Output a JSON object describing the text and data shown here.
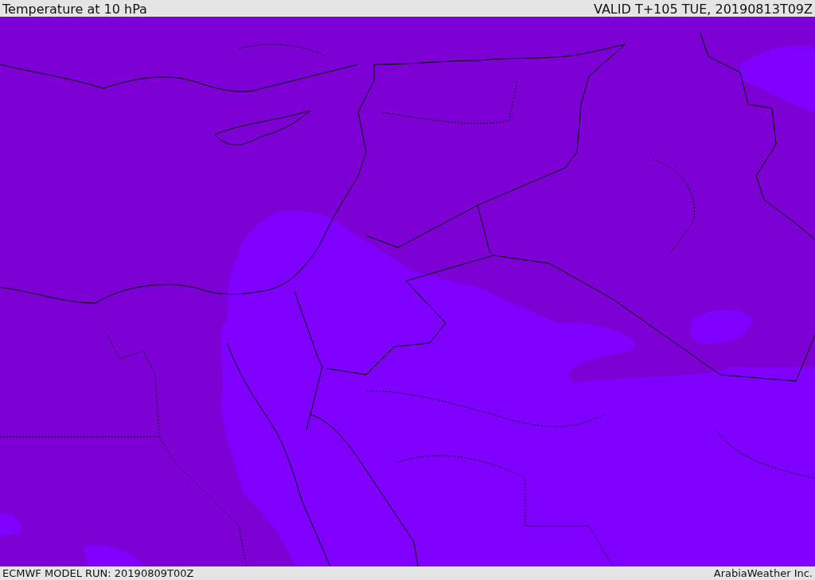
{
  "header": {
    "title": "Temperature at 10 hPa",
    "valid_time": "VALID T+105 TUE, 20190813T09Z"
  },
  "footer": {
    "model_run": "ECMWF MODEL RUN: 20190809T00Z",
    "credit": "ArabiaWeather Inc."
  }
}
